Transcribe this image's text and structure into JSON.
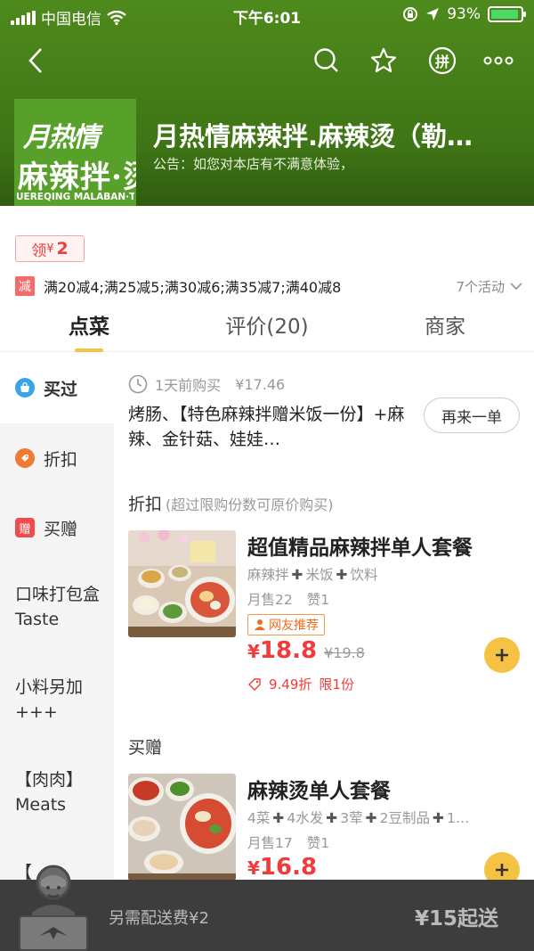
{
  "status_bar": {
    "carrier": "中国电信",
    "time": "下午6:01",
    "battery": "93%"
  },
  "shop": {
    "name": "月热情麻辣拌.麻辣烫（勒…",
    "notice": "公告：如您对本店有不满意体验，",
    "logo_line1": "月热情",
    "logo_line2": "麻辣拌·烫",
    "logo_line3": "UEREQING MALABAN·TAN"
  },
  "nav": {
    "pin_label": "拼"
  },
  "coupon": {
    "label": "领",
    "currency": "¥",
    "amount": "2"
  },
  "promo": {
    "tag": "减",
    "text": "满20减4;满25减5;满30减6;满35减7;满40减8",
    "more": "7个活动"
  },
  "tabs": [
    {
      "label": "点菜"
    },
    {
      "label": "评价(20)"
    },
    {
      "label": "商家"
    }
  ],
  "sidebar": {
    "items": [
      {
        "label": "买过",
        "icon": "bag-icon",
        "color": "#3ba3e8"
      },
      {
        "label": "折扣",
        "icon": "discount-icon",
        "color": "#f07a32"
      },
      {
        "label": "买赠",
        "icon": "gift-icon",
        "glyph": "赠",
        "color": "#f24b4b"
      },
      {
        "label": "口味打包盒Taste"
      },
      {
        "label": "小料另加+++"
      },
      {
        "label": "【肉肉】Meats"
      },
      {
        "label": "【"
      }
    ]
  },
  "bought": {
    "time": "1天前购买",
    "price": "¥17.46",
    "desc": "烤肠、【特色麻辣拌赠米饭一份】+麻辣、金针菇、娃娃…",
    "reorder": "再来一单"
  },
  "sections": {
    "discount": {
      "title": "折扣",
      "sub": "(超过限购份数可原价购买)"
    },
    "gift": {
      "title": "买赠"
    }
  },
  "dishes": [
    {
      "name": "超值精品麻辣拌单人套餐",
      "components": [
        "麻辣拌",
        "米饭",
        "饮料"
      ],
      "sold": "月售22",
      "likes": "赞1",
      "badge": "网友推荐",
      "currency": "¥",
      "price": "18.8",
      "orig": "¥19.8",
      "discount": "9.49折",
      "limit": "限1份"
    },
    {
      "name": "麻辣烫单人套餐",
      "components": [
        "4菜",
        "4水发",
        "3荤",
        "2豆制品",
        "1…"
      ],
      "sold": "月售17",
      "likes": "赞1",
      "currency": "¥",
      "price": "16.8"
    }
  ],
  "bottom": {
    "fee": "另需配送费¥2",
    "min_order": "¥15起送"
  },
  "colors": {
    "accent": "#f6c243",
    "price": "#f23b3b",
    "header": "#4e8a1c"
  }
}
